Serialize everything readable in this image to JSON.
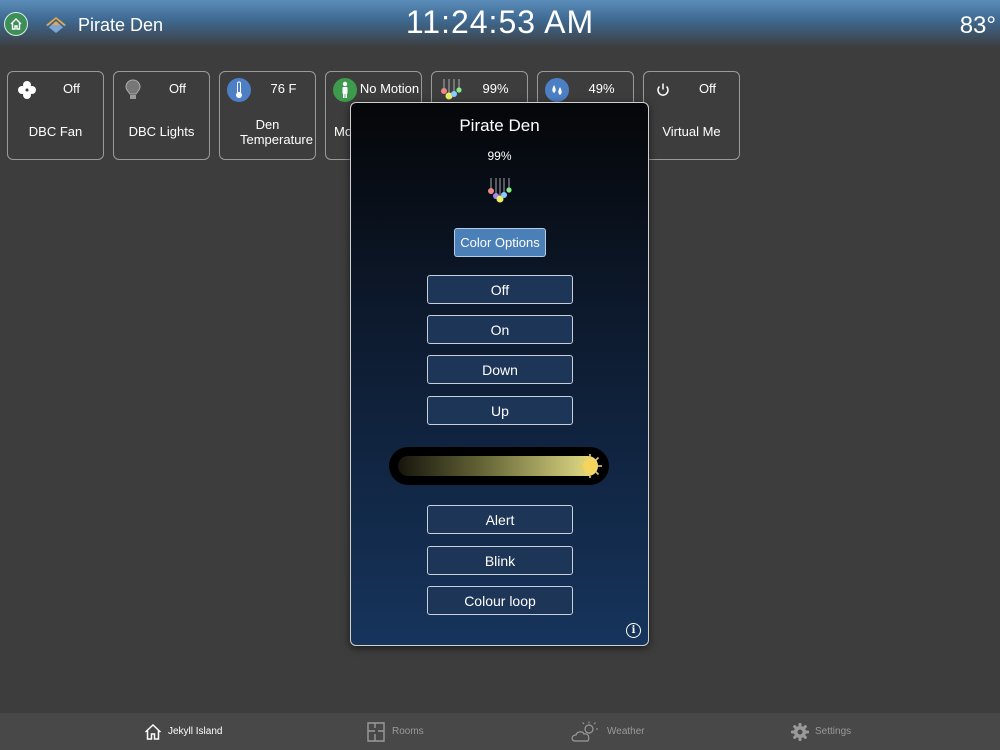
{
  "header": {
    "room_title": "Pirate Den",
    "clock": "11:24:53 AM",
    "outside_temp": "83°"
  },
  "tiles": [
    {
      "name": "DBC Fan",
      "status": "Off",
      "icon": "fan-icon"
    },
    {
      "name": "DBC Lights",
      "status": "Off",
      "icon": "light-bulb-icon"
    },
    {
      "name": "Den Temperature",
      "status": "76 F",
      "icon": "thermometer-icon"
    },
    {
      "name": "Mo",
      "status": "No Motion",
      "icon": "person-icon"
    },
    {
      "name": "",
      "status": "99%",
      "icon": "color-bulbs-icon"
    },
    {
      "name": "",
      "status": "49%",
      "icon": "water-drops-icon"
    },
    {
      "name": "Virtual Me",
      "status": "Off",
      "icon": "power-icon"
    }
  ],
  "popup": {
    "title": "Pirate Den",
    "level": "99%",
    "level_value": 0.99,
    "color_options_label": "Color Options",
    "commands": [
      "Off",
      "On",
      "Down",
      "Up"
    ],
    "effects": [
      "Alert",
      "Blink",
      "Colour loop"
    ]
  },
  "bottom_nav": [
    {
      "label": "Jekyll Island",
      "icon": "home-icon",
      "active": true
    },
    {
      "label": "Rooms",
      "icon": "floorplan-icon",
      "active": false
    },
    {
      "label": "Weather",
      "icon": "cloud-sun-icon",
      "active": false
    },
    {
      "label": "Settings",
      "icon": "gear-icon",
      "active": false
    }
  ],
  "colors": {
    "background": "#3d3d3d",
    "header_blue": "#5b8dba",
    "button_blue": "#4a7fb8",
    "command_button": "#1d3557"
  }
}
